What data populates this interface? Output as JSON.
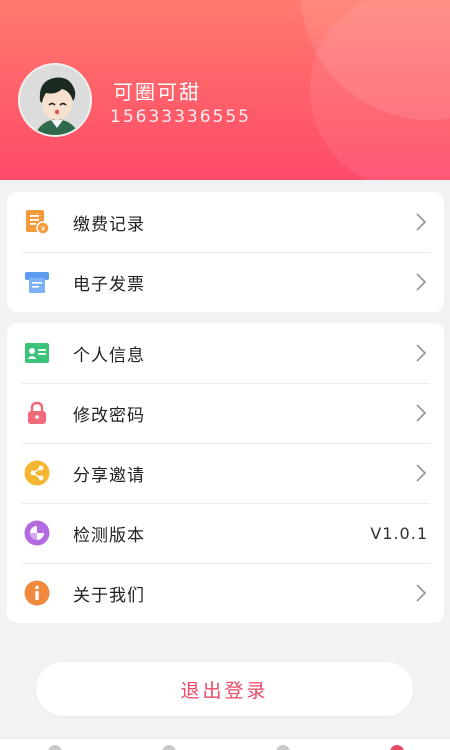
{
  "profile": {
    "name": "可圈可甜",
    "phone": "15633336555"
  },
  "menu_group_1": [
    {
      "label": "缴费记录",
      "icon": "payment-record-icon"
    },
    {
      "label": "电子发票",
      "icon": "invoice-icon"
    }
  ],
  "menu_group_2": [
    {
      "label": "个人信息",
      "icon": "id-card-icon"
    },
    {
      "label": "修改密码",
      "icon": "lock-icon"
    },
    {
      "label": "分享邀请",
      "icon": "share-icon"
    },
    {
      "label": "检测版本",
      "icon": "version-icon",
      "value": "V1.0.1"
    },
    {
      "label": "关于我们",
      "icon": "info-icon"
    }
  ],
  "logout_label": "退出登录",
  "colors": {
    "header_start": "#ff7b6e",
    "header_end": "#ff4a6b",
    "logout_text": "#e84a67"
  }
}
